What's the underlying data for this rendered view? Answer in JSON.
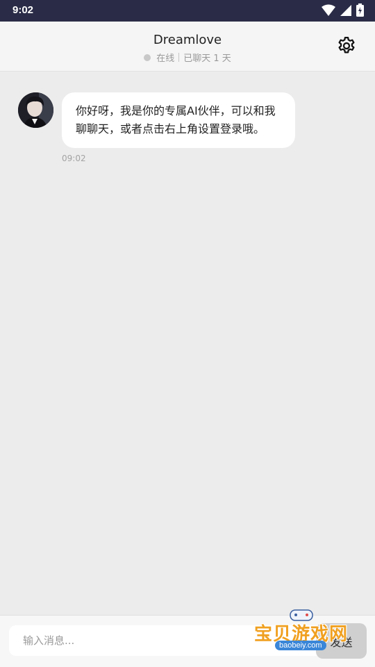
{
  "status_bar": {
    "time": "9:02"
  },
  "header": {
    "title": "Dreamlove",
    "presence": "在线",
    "chat_duration": "已聊天 1 天",
    "settings_icon": "gear-icon"
  },
  "messages": [
    {
      "sender": "bot",
      "text": "你好呀，我是你的专属AI伙伴，可以和我聊聊天，或者点击右上角设置登录哦。",
      "time": "09:02"
    }
  ],
  "composer": {
    "placeholder": "输入消息...",
    "send_label": "发送"
  },
  "watermark": {
    "brand": "宝贝游戏网",
    "url": "baobeiy.com"
  },
  "colors": {
    "status_bar": "#2a2c47",
    "chat_bg": "#ececec",
    "bubble": "#ffffff",
    "send_button": "#cfcfcf"
  }
}
